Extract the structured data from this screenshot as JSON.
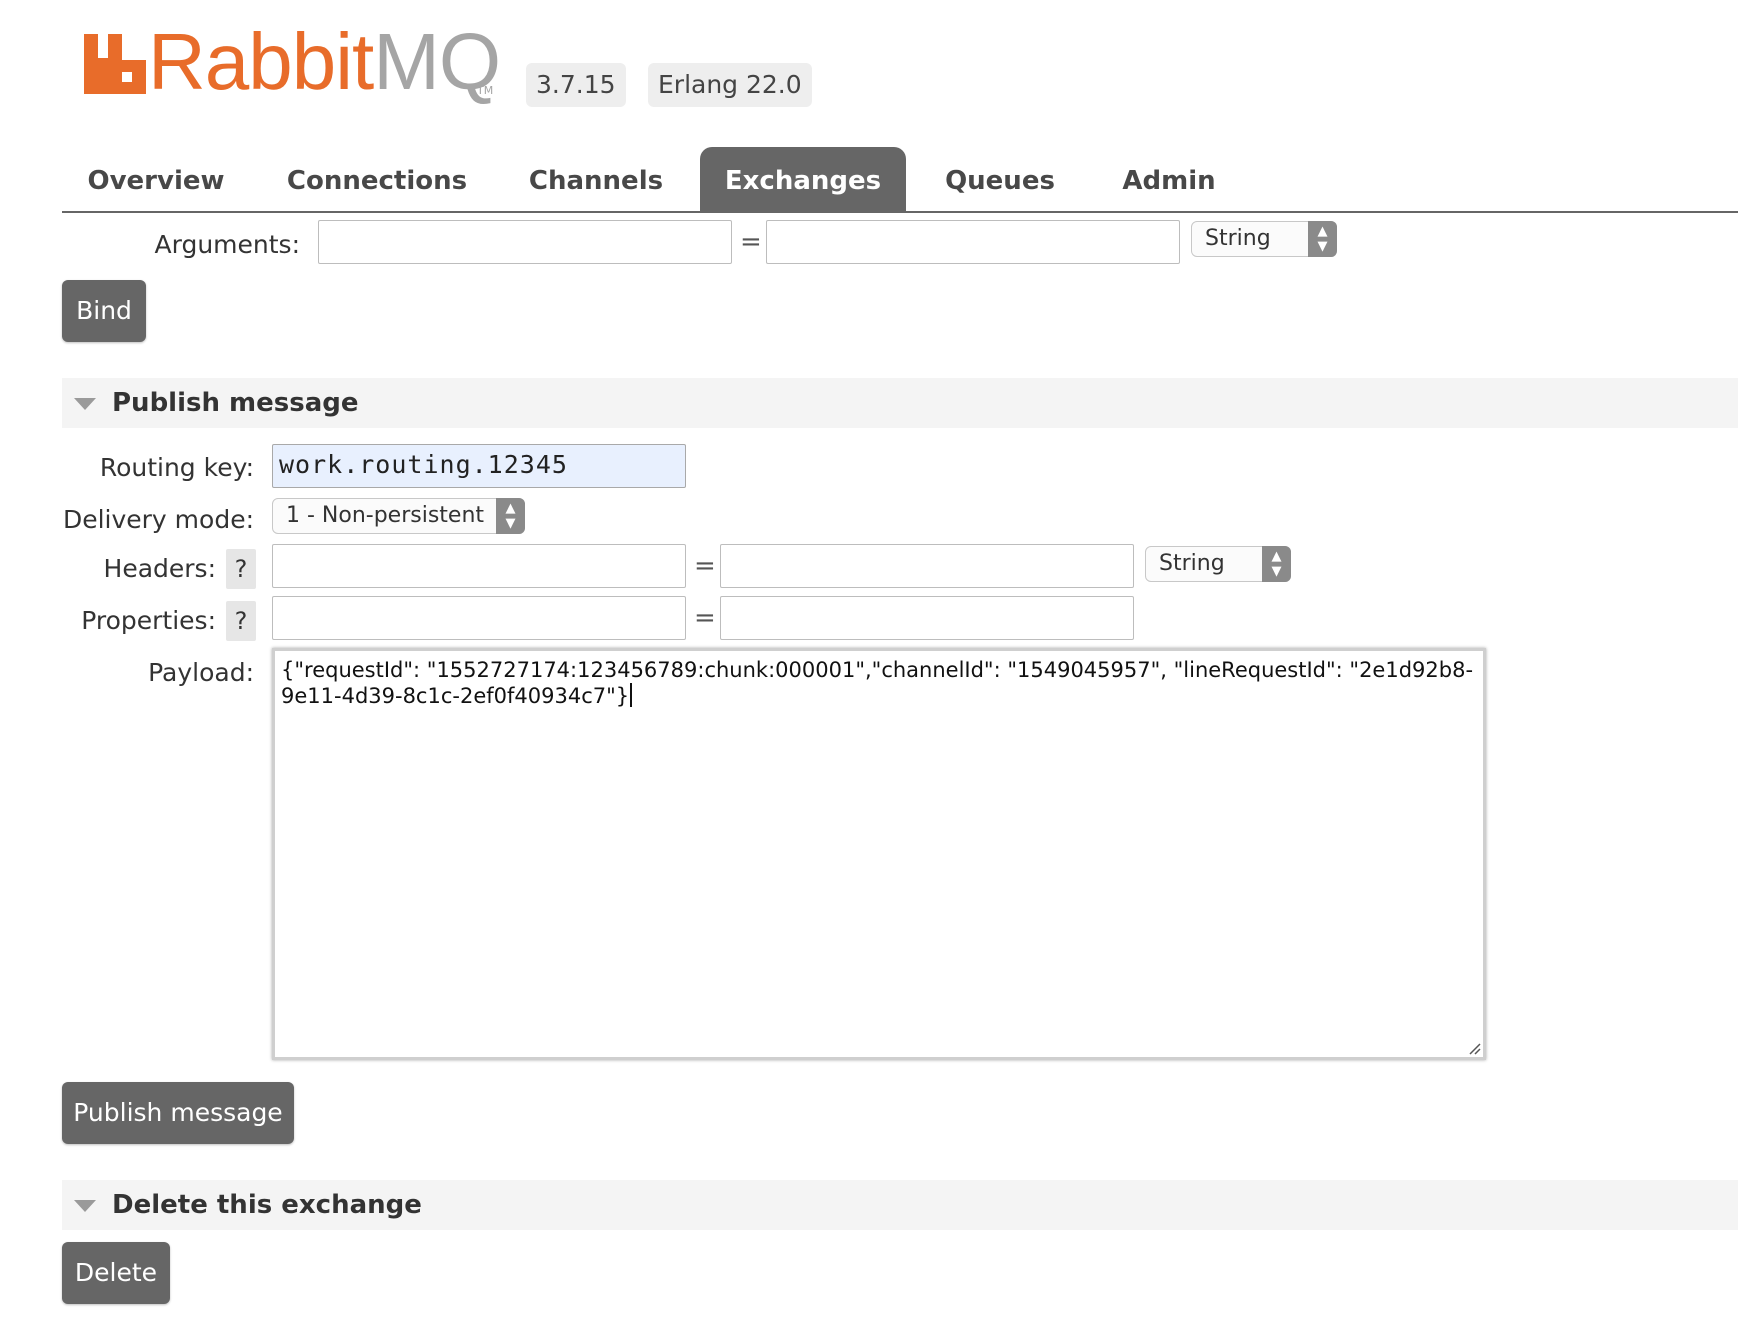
{
  "header": {
    "logo_text": "RabbitMQ",
    "logo_tm": "TM",
    "version": "3.7.15",
    "erlang": "Erlang 22.0"
  },
  "nav": {
    "tabs": [
      {
        "label": "Overview",
        "active": false
      },
      {
        "label": "Connections",
        "active": false
      },
      {
        "label": "Channels",
        "active": false
      },
      {
        "label": "Exchanges",
        "active": true
      },
      {
        "label": "Queues",
        "active": false
      },
      {
        "label": "Admin",
        "active": false
      }
    ]
  },
  "bind_form": {
    "arguments_label": "Arguments:",
    "arguments_key": "",
    "equals": "=",
    "arguments_value": "",
    "arguments_type": "String",
    "bind_button": "Bind"
  },
  "publish": {
    "section_title": "Publish message",
    "routing_key_label": "Routing key:",
    "routing_key": "work.routing.12345",
    "delivery_mode_label": "Delivery mode:",
    "delivery_mode": "1 - Non-persistent",
    "headers_label": "Headers:",
    "headers_help": "?",
    "headers_type": "String",
    "properties_label": "Properties:",
    "properties_help": "?",
    "payload_label": "Payload:",
    "payload": "{\"requestId\": \"1552727174:123456789:chunk:000001\",\"channelId\": \"1549045957\", \"lineRequestId\": \"2e1d92b8-9e11-4d39-8c1c-2ef0f40934c7\"}",
    "publish_button": "Publish message"
  },
  "delete": {
    "section_title": "Delete this exchange",
    "delete_button": "Delete"
  },
  "colors": {
    "logo_orange": "#e86c2a",
    "logo_grey": "#a5a5a5",
    "active_tab": "#666666",
    "button": "#666666",
    "routing_key_bg": "#e8f0fe"
  }
}
